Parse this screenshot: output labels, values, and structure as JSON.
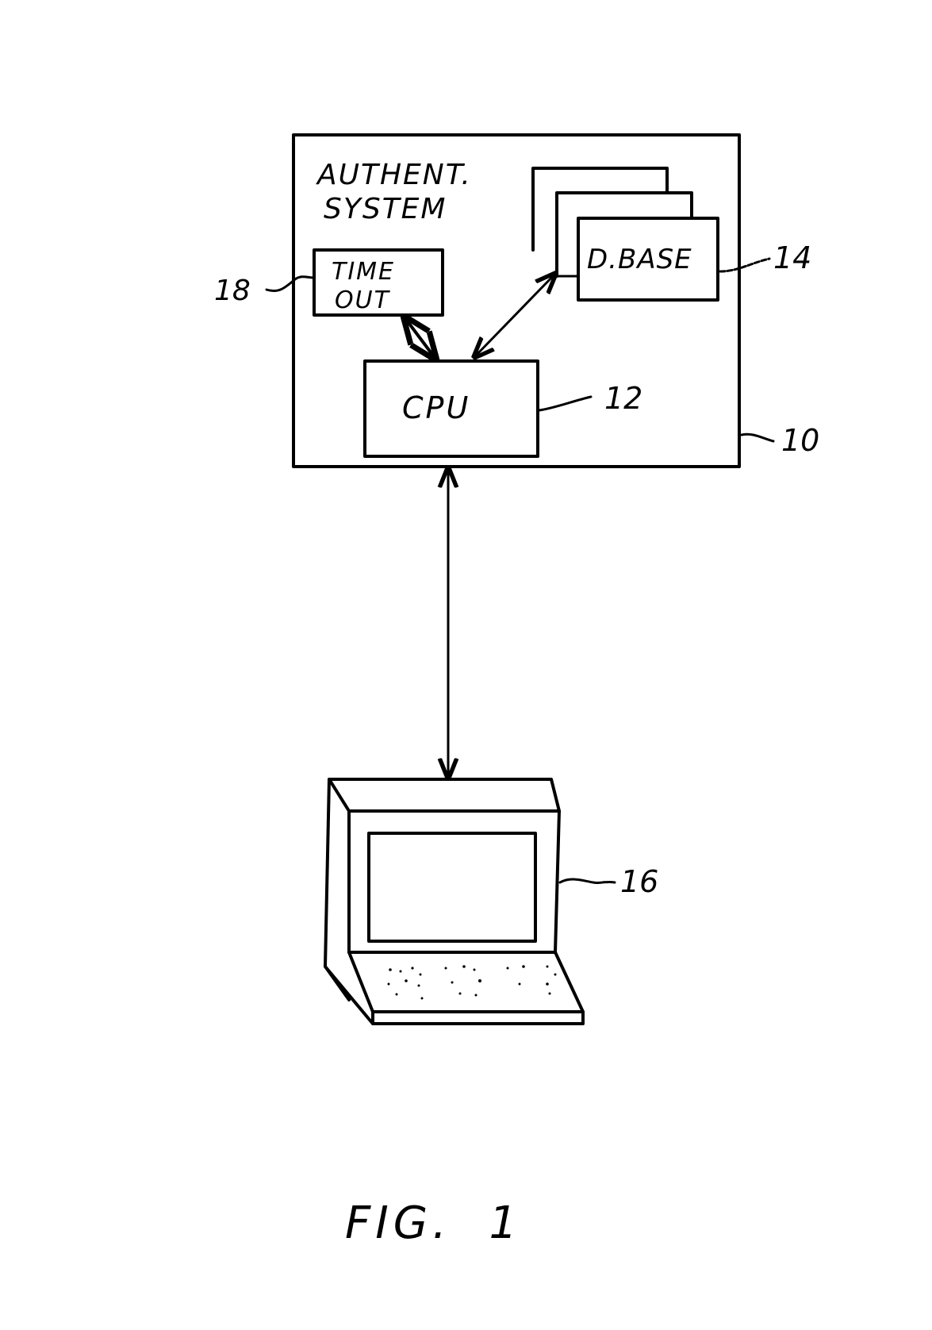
{
  "figure": {
    "caption": "FIG.  1",
    "ink_color": "#000000",
    "paper_color": "#ffffff"
  },
  "system": {
    "title_line1": "AUTHENT.",
    "title_line2": "SYSTEM",
    "ref": "10"
  },
  "timeout": {
    "line1": "TIME",
    "line2": "OUT",
    "ref": "18"
  },
  "database": {
    "label": "D.BASE",
    "ref": "14"
  },
  "cpu": {
    "label": "CPU",
    "ref": "12"
  },
  "terminal": {
    "ref": "16"
  },
  "connections": [
    {
      "from": "timeout",
      "to": "cpu",
      "type": "bidirectional"
    },
    {
      "from": "database",
      "to": "cpu",
      "type": "bidirectional"
    },
    {
      "from": "cpu",
      "to": "terminal",
      "type": "bidirectional"
    }
  ]
}
